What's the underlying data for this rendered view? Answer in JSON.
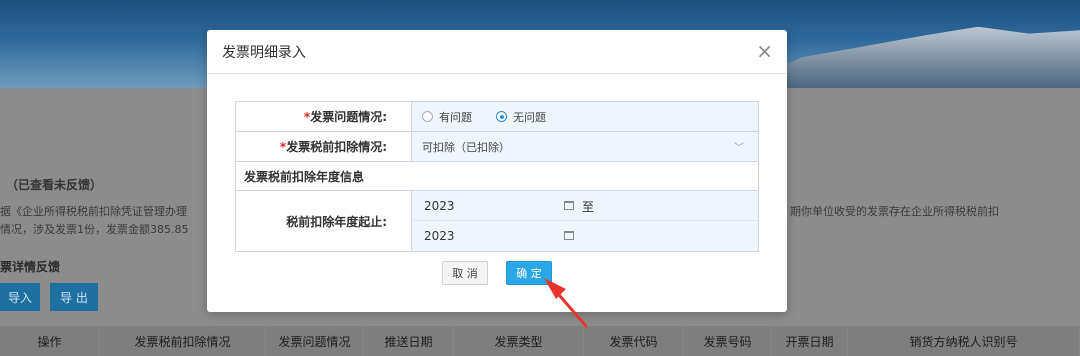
{
  "background": {
    "section_title": "（已查看未反馈）",
    "text_line1_left": "据《企业所得税税前扣除凭证管理办理",
    "text_line2_left": "情况，涉及发票1份，发票金额385.85",
    "text_line1_right": "期你单位收受的发票存在企业所得税税前扣",
    "text_line2_right": "",
    "details_title": "票详情反馈",
    "import_label": "导入",
    "export_label": "导 出",
    "columns": [
      "操作",
      "发票税前扣除情况",
      "发票问题情况",
      "推送日期",
      "发票类型",
      "发票代码",
      "发票号码",
      "开票日期",
      "销货方纳税人识别号"
    ]
  },
  "modal": {
    "title": "发票明细录入",
    "close_glyph": "×",
    "problem_label": "发票问题情况:",
    "problem_required": "*",
    "problem_options": [
      "有问题",
      "无问题"
    ],
    "problem_selected": "无问题",
    "deduct_label": "发票税前扣除情况:",
    "deduct_required": "*",
    "deduct_value": "可扣除（已扣除）",
    "deduct_chevron": "﹀",
    "year_section_label": "发票税前扣除年度信息",
    "year_range_label": "税前扣除年度起止:",
    "year_start": "2023",
    "year_end": "2023",
    "to_label": "至",
    "cancel_label": "取 消",
    "ok_label": "确 定"
  },
  "colors": {
    "accent": "#29a7e6",
    "required": "#e02020",
    "annotation_arrow": "#e8352c"
  }
}
